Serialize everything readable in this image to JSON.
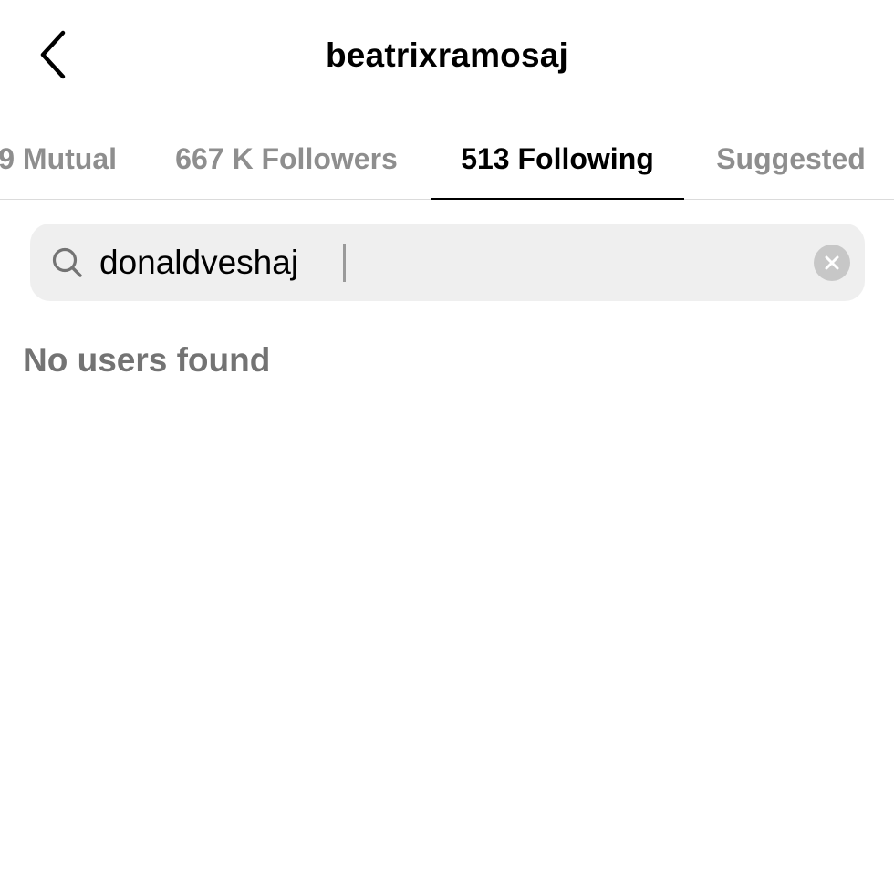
{
  "header": {
    "title": "beatrixramosaj",
    "back_icon": "chevron-left-icon"
  },
  "tabs": {
    "mutual": "9 Mutual",
    "followers": "667 K Followers",
    "following": "513 Following",
    "suggested": "Suggested",
    "active": "following"
  },
  "search": {
    "value": "donaldveshaj",
    "icon": "search-icon",
    "clear_icon": "clear-icon"
  },
  "results": {
    "empty_message": "No users found"
  },
  "colors": {
    "background": "#ffffff",
    "text_primary": "#000000",
    "text_inactive": "#8e8e8e",
    "search_bg": "#efefef",
    "divider": "#dbdbdb"
  }
}
